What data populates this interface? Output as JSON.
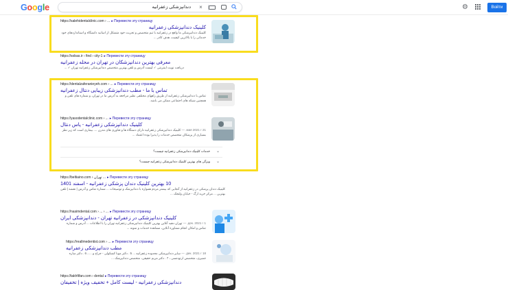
{
  "header": {
    "search_query": "دندانپزشکی زعفرانیه",
    "sign_in": "Войти"
  },
  "results": [
    {
      "cite": "https://salehidentalclinic.com › ...",
      "translate": "Перевести эту страницу",
      "title": "کلینیک دندانپزشکی زعفرانیه",
      "snippet": "کلینیک دندانپزشکی ما واقع در زعفرانیه با تیم متخصص و تجربت خود متشکل از اساتید دانشگاه و استانداردهای خود خدماتی را با بالاترین کیفیت، هدف کادر ..."
    },
    {
      "cite": "https://sobas.ir › find › city-1",
      "translate": "Перевести эту страницу",
      "title": "معرفی بهترین دندانپزشکان در تهران در محله زعفرانیه",
      "snippet": "دریافت نوبت اینترنتی ✓ لیست آدرس و تلفن بهترین متخصص دندانپزشکی زعفرانیه تهران ✓ ..."
    },
    {
      "cite": "https://dentalzaferanieyeh.com › ...",
      "translate": "Перевести эту страницу",
      "title": "تماس با ما - مطب دندانپزشکی زیبایی دنتال زعفرانیه",
      "snippet": "تماس با دندانپزشکی زعفرانیه از طریق راههای مختلفی نظیر مراجعه به آدرس ما در تهران، و شماره های تلفن و همچنین شبکه های اجتماعی ممکن می باشد."
    },
    {
      "cite": "https://yasodentalclinic.com › ...",
      "translate": "Перевести эту страницу",
      "title": "کلینیک دندانپزشکی زعفرانیه - یاس دنتال",
      "date": "21 мая 2021 г. —",
      "snippet": "کلینیک دندانپزشکی زعفرانیه دارای دستگاه ها و فناوری های مدرن .... بیماری است که زیر نظر بسیاری از پزشکان متخصص خدمات را پذیرا بوده اعتماد ..."
    },
    {
      "cite": "https://beltiaino.com › تهران ...",
      "translate": "Перевести эту страницу",
      "title": "10 بهترین کلینیک دندان پزشکی زعفرانیه - اسفند 1401",
      "snippet": "کلینیک دندان پزشکی در زعفرانیه از آنجایی که بیشتر مردم همواره با دندانپزشک و توضیحات ... شماره تماس و آدرس | نقشه | تلفن بهترین ... مرکز خرید ارگ - خیابان ولنجک ..."
    },
    {
      "cite": "https://nasimdental.com › ... › ...",
      "translate": "Перевести эту страницу",
      "title": "کلینیک دندانپزشکی در زعفرانیه تهران - دندانپزشکی ایران",
      "date": "1 дек. 2021 г. —",
      "snippet": "تهران دهید آنلاین بهترین کلینیک دندانپزشکی زعفرانیه تهران را با اطلاعات ... آدرس و شماره تماس و امکان انجام مشاوره آنلاین، مشاهده خدمات و نمونه ..."
    },
    {
      "cite": "https://reallmedentist.com › ...",
      "translate": "Перевести эту страницу",
      "title": "مطب دندانپزشکی زعفرانیه",
      "date": "18 дек. 2021 г. —",
      "snippet": "سایر دندانپزشکی محدوده زعفرانیه ... 5 . دکتر مونا کشکولی - جراح و ... ، 6 . دکتر ساره جمیزی، متخصص ارتودنسی ، 7 . دکتر مریم حقیقی، متخصص دندانپزشک ..."
    },
    {
      "cite": "https://takhfifan.com › dental",
      "translate": "Перевести эту страницу",
      "title": "دندانپزشکی زعفرانیه - لیست کامل + تخفیف ویژه | تخفیفان",
      "snippet": ""
    }
  ],
  "accordion": [
    "خدمات کلینیک دندانپزشکی زعفرانیه چیست؟",
    "ویژگی های بهترین کلینیک دندانپزشکی زعفرانیه چیست؟"
  ]
}
